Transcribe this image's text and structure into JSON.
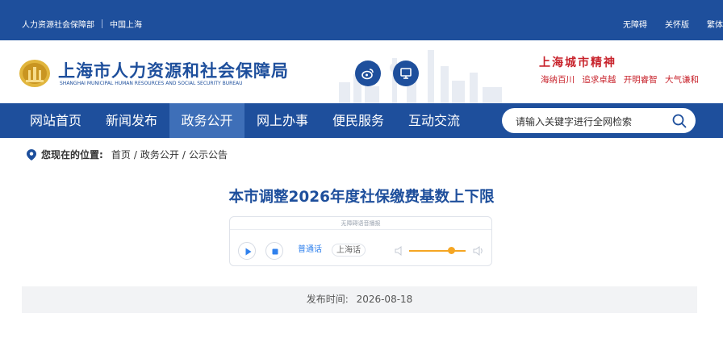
{
  "topbar": {
    "org": "人力资源社会保障部",
    "region": "中国上海",
    "links": [
      "无障碍",
      "关怀版",
      "繁体"
    ]
  },
  "header": {
    "title_cn": "上海市人力资源和社会保障局",
    "title_en": "SHANGHAI MUNICIPAL HUMAN RESOURCES AND SOCIAL SECURITY BUREAU",
    "weibo_icon": "weibo-icon",
    "screen_icon": "monitor-icon",
    "spirit_title": "上海城市精神",
    "spirit_items": [
      "海纳百川",
      "追求卓越",
      "开明睿智",
      "大气谦和"
    ]
  },
  "nav": {
    "items": [
      "网站首页",
      "新闻发布",
      "政务公开",
      "网上办事",
      "便民服务",
      "互动交流"
    ],
    "active_index": 2,
    "search_placeholder": "请输入关键字进行全网检索"
  },
  "breadcrumb": {
    "label": "您现在的位置:",
    "items": [
      "首页",
      "政务公开",
      "公示公告"
    ]
  },
  "article": {
    "title": "本市调整2026年度社保缴费基数上下限",
    "publish_label": "发布时间:",
    "publish_date": "2026-08-18"
  },
  "player": {
    "header_text": "无障碍语音播报",
    "dialects": [
      "普通话",
      "上海话"
    ],
    "active_dialect": "普通话",
    "volume": 0.75
  },
  "colors": {
    "brand": "#1e4f9c",
    "nav_active": "#3e6fb8",
    "accent_red": "#c8232c",
    "volume": "#f5a623"
  }
}
